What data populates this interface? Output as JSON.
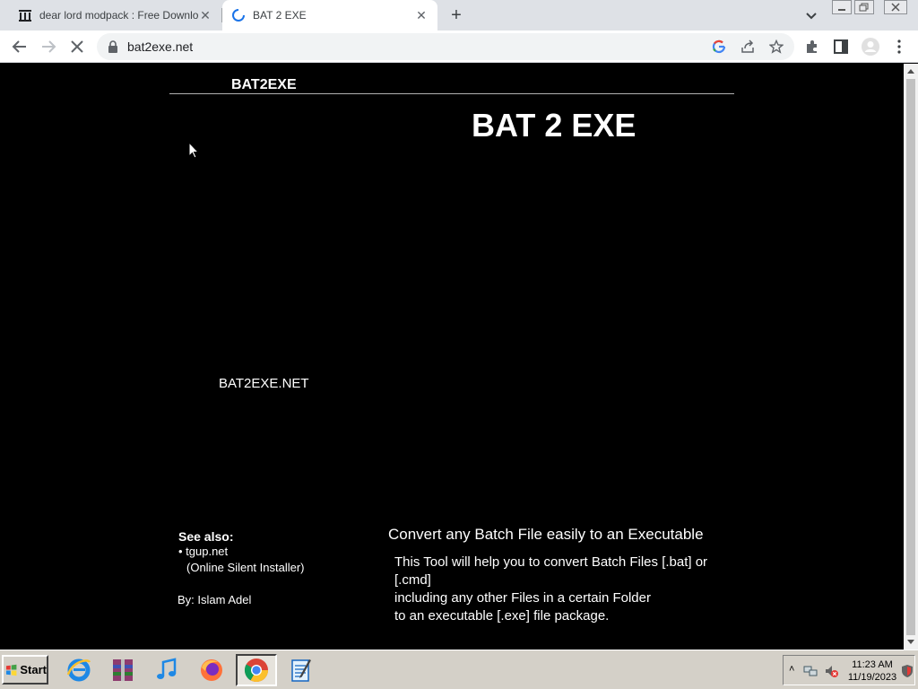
{
  "browser": {
    "tabs": [
      {
        "title": "dear lord modpack : Free Download",
        "active": false
      },
      {
        "title": "BAT 2 EXE",
        "active": true
      }
    ],
    "url": "bat2exe.net"
  },
  "page": {
    "site_logo": "BAT2EXE",
    "hero_title": "BAT 2 EXE",
    "side_label": "BAT2EXE.NET",
    "see_also": {
      "title": "See also:",
      "link": "• tgup.net",
      "link_desc": "(Online Silent Installer)"
    },
    "author": "By: Islam Adel",
    "tagline": "Convert any Batch File easily to an Executable",
    "description": [
      "This Tool will help you to convert Batch Files [.bat] or",
      "[.cmd]",
      "including any other Files in a certain Folder",
      "to an executable [.exe] file package."
    ]
  },
  "taskbar": {
    "start_label": "Start",
    "apps": [
      "internet-explorer-icon",
      "winrar-icon",
      "itunes-icon",
      "firefox-icon",
      "chrome-icon",
      "notepad-icon"
    ],
    "time": "11:23 AM",
    "date": "11/19/2023"
  },
  "colors": {
    "page_bg": "#000000",
    "page_text": "#ffffff",
    "tabstrip_bg": "#dee1e6",
    "taskbar_bg": "#d4d0c8"
  }
}
